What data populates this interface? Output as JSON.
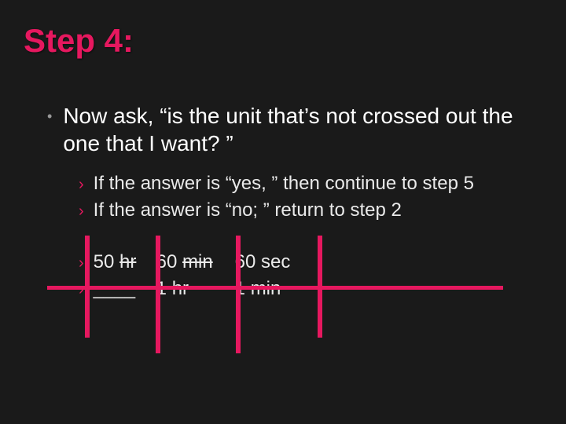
{
  "title": "Step 4:",
  "main": "Now ask, “is the unit that’s not crossed out the one that I want? ”",
  "subs": [
    "If the answer is “yes, ” then continue to step 5",
    "If the answer is “no; ” return to step 2"
  ],
  "math": {
    "row1": {
      "c1a": "50 ",
      "c1b": "hr",
      "c2a": "60 ",
      "c2b": "min",
      "c3a": "60 sec"
    },
    "row2": {
      "c1": "____",
      "c2a": "1 ",
      "c2b": "hr",
      "c3a": "1 ",
      "c3b": "min"
    }
  }
}
